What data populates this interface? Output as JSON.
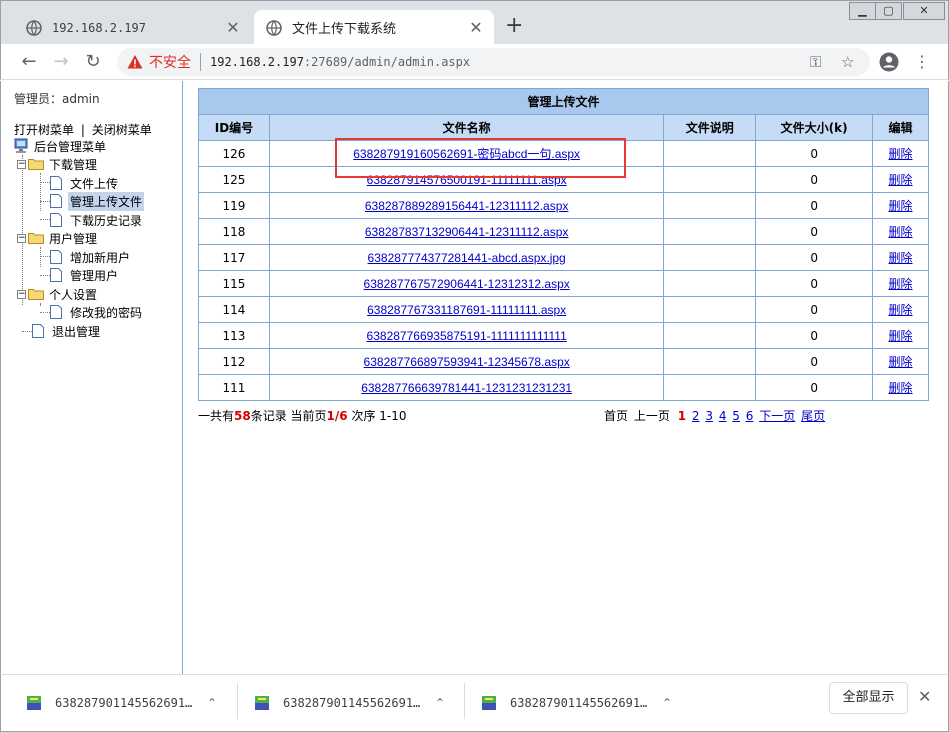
{
  "browser": {
    "tabs": [
      {
        "title": "192.168.2.197",
        "active": false
      },
      {
        "title": "文件上传下载系统",
        "active": true
      }
    ],
    "new_tab": "+",
    "security_label": "不安全",
    "url_host": "192.168.2.197",
    "url_rest": ":27689/admin/admin.aspx"
  },
  "sidebar": {
    "admin_label": "管理员：admin",
    "open_tree": "打开树菜单",
    "divider": "|",
    "close_tree": "关闭树菜单",
    "root": "后台管理菜单",
    "groups": [
      {
        "label": "下载管理",
        "items": [
          "文件上传",
          "管理上传文件",
          "下载历史记录"
        ]
      },
      {
        "label": "用户管理",
        "items": [
          "增加新用户",
          "管理用户"
        ]
      },
      {
        "label": "个人设置",
        "items": [
          "修改我的密码"
        ]
      }
    ],
    "logout": "退出管理",
    "selected_item": "管理上传文件"
  },
  "table": {
    "caption": "管理上传文件",
    "headers": [
      "ID编号",
      "文件名称",
      "文件说明",
      "文件大小(k)",
      "编辑"
    ],
    "rows": [
      {
        "id": "126",
        "name": "638287919160562691-密码abcd一句.aspx",
        "desc": "",
        "size": "0",
        "action": "删除"
      },
      {
        "id": "125",
        "name": "638287914576500191-11111111.aspx",
        "desc": "",
        "size": "0",
        "action": "删除"
      },
      {
        "id": "119",
        "name": "638287889289156441-12311112.aspx",
        "desc": "",
        "size": "0",
        "action": "删除"
      },
      {
        "id": "118",
        "name": "638287837132906441-12311112.aspx",
        "desc": "",
        "size": "0",
        "action": "删除"
      },
      {
        "id": "117",
        "name": "638287774377281441-abcd.aspx.jpg",
        "desc": "",
        "size": "0",
        "action": "删除"
      },
      {
        "id": "115",
        "name": "638287767572906441-12312312.aspx",
        "desc": "",
        "size": "0",
        "action": "删除"
      },
      {
        "id": "114",
        "name": "638287767331187691-11111111.aspx",
        "desc": "",
        "size": "0",
        "action": "删除"
      },
      {
        "id": "113",
        "name": "638287766935875191-1111111111111",
        "desc": "",
        "size": "0",
        "action": "删除"
      },
      {
        "id": "112",
        "name": "638287766897593941-12345678.aspx",
        "desc": "",
        "size": "0",
        "action": "删除"
      },
      {
        "id": "111",
        "name": "638287766639781441-1231231231231",
        "desc": "",
        "size": "0",
        "action": "删除"
      }
    ]
  },
  "pager": {
    "prefix": "一共有",
    "total": "58",
    "records_text": "条记录 当前页",
    "current_of": "1/6",
    "range_text": " 次序 1-10",
    "first": "首页",
    "prev": "上一页",
    "current_page": "1",
    "pages": [
      "2",
      "3",
      "4",
      "5",
      "6"
    ],
    "next": "下一页",
    "last": "尾页"
  },
  "downloads": {
    "items": [
      {
        "name": "638287901145562691…"
      },
      {
        "name": "638287901145562691…"
      },
      {
        "name": "638287901145562691…"
      }
    ],
    "show_all": "全部显示"
  }
}
